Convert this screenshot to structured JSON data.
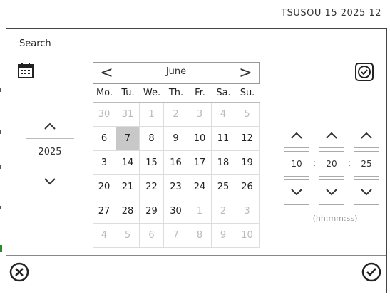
{
  "topbar": {
    "datetime": "TSUSOU 15 2025  12"
  },
  "dialog": {
    "title": "Search"
  },
  "calendar": {
    "month": "June",
    "prev_label": "<",
    "next_label": ">",
    "weekdays": [
      "Mo.",
      "Tu.",
      "We.",
      "Th.",
      "Fr.",
      "Sa.",
      "Su."
    ],
    "weeks": [
      [
        "30",
        "31",
        "1",
        "2",
        "3",
        "4",
        "5"
      ],
      [
        "6",
        "7",
        "8",
        "9",
        "10",
        "11",
        "12"
      ],
      [
        "3",
        "14",
        "15",
        "16",
        "17",
        "18",
        "19"
      ],
      [
        "20",
        "21",
        "22",
        "23",
        "24",
        "25",
        "26"
      ],
      [
        "27",
        "28",
        "29",
        "30",
        "1",
        "2",
        "3"
      ],
      [
        "4",
        "5",
        "6",
        "7",
        "8",
        "9",
        "10"
      ]
    ],
    "muted": [
      [
        true,
        true,
        true,
        true,
        true,
        true,
        true
      ],
      [
        false,
        false,
        false,
        false,
        false,
        false,
        false
      ],
      [
        false,
        false,
        false,
        false,
        false,
        false,
        false
      ],
      [
        false,
        false,
        false,
        false,
        false,
        false,
        false
      ],
      [
        false,
        false,
        false,
        false,
        true,
        true,
        true
      ],
      [
        true,
        true,
        true,
        true,
        true,
        true,
        true
      ]
    ],
    "selected": {
      "week": 1,
      "day": 1
    }
  },
  "year": {
    "value": "2025"
  },
  "time": {
    "hour": "10",
    "minute": "20",
    "second": "25",
    "hint": "(hh:mm:ss)"
  },
  "colors": {
    "selected": "#c8c8c8",
    "muted_text": "#bbbbbb",
    "border": "#999999"
  },
  "icons": {
    "calendar": "calendar-icon",
    "clock": "clock-icon",
    "up": "chevron-up-icon",
    "down": "chevron-down-icon",
    "cancel": "close-circle-icon",
    "ok": "check-circle-icon"
  }
}
